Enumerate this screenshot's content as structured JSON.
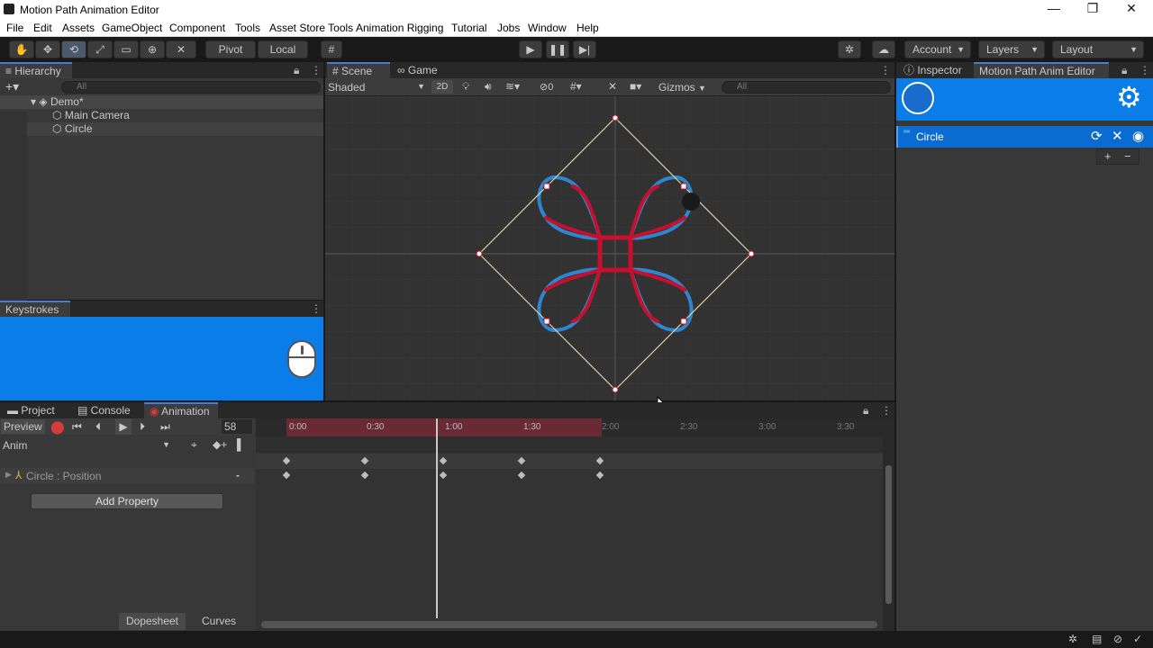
{
  "window": {
    "title": "Motion Path Animation Editor",
    "minimize": "—",
    "maximize": "❐",
    "close": "✕"
  },
  "menu": [
    "File",
    "Edit",
    "Assets",
    "GameObject",
    "Component",
    "Tools",
    "Asset Store Tools",
    "Animation Rigging",
    "Tutorial",
    "Jobs",
    "Window",
    "Help"
  ],
  "toolbar": {
    "pivot": "Pivot",
    "local": "Local",
    "account": "Account",
    "layers": "Layers",
    "layout": "Layout",
    "play_icon": "play-icon",
    "pause_icon": "pause-icon",
    "step_icon": "step-icon"
  },
  "hierarchy": {
    "tab": "Hierarchy",
    "search_placeholder": "All",
    "scene": "Demo*",
    "items": [
      "Main Camera",
      "Circle"
    ]
  },
  "keystrokes": {
    "tab": "Keystrokes",
    "icon": "mouse-icon"
  },
  "scene_view": {
    "tabs": [
      "Scene",
      "Game"
    ],
    "shading": "Shaded",
    "mode_2d": "2D",
    "hidden_count": "0",
    "gizmos": "Gizmos",
    "search_placeholder": "All"
  },
  "inspector": {
    "tabs": [
      "Inspector",
      "Motion Path Anim Editor"
    ],
    "item": "Circle",
    "add": "+",
    "remove": "−"
  },
  "animation": {
    "tabs": [
      "Project",
      "Console",
      "Animation"
    ],
    "preview": "Preview",
    "frame": "58",
    "clip": "Anim",
    "property": "Circle : Position",
    "add_property": "Add Property",
    "ruler": [
      "0:00",
      "0:30",
      "1:00",
      "1:30",
      "2:00",
      "2:30",
      "3:00",
      "3:30"
    ],
    "bottom_tabs": [
      "Dopesheet",
      "Curves"
    ],
    "collapse": "-"
  },
  "colors": {
    "accent": "#0a7de8",
    "record": "#d43b3b",
    "path_blue": "#2f8fe0",
    "path_red": "#c8102e"
  }
}
